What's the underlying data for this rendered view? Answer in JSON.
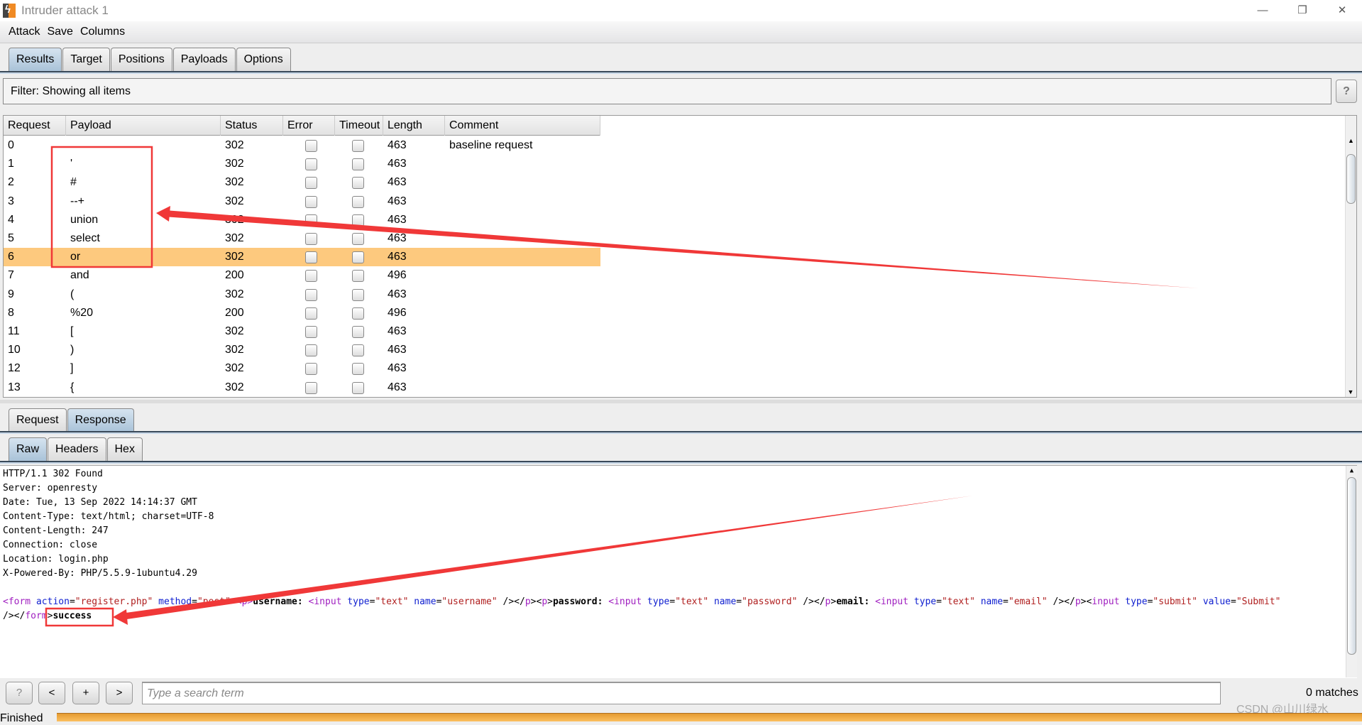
{
  "window": {
    "title": "Intruder attack 1",
    "icon": "burp-icon"
  },
  "menu": [
    "Attack",
    "Save",
    "Columns"
  ],
  "tabs": [
    "Results",
    "Target",
    "Positions",
    "Payloads",
    "Options"
  ],
  "filter": {
    "label": "Filter: Showing all items",
    "help": "?"
  },
  "table": {
    "columns": [
      "Request",
      "Payload",
      "Status",
      "Error",
      "Timeout",
      "Length",
      "Comment"
    ],
    "rows": [
      {
        "request": "0",
        "payload": "",
        "status": "302",
        "length": "463",
        "comment": "baseline request"
      },
      {
        "request": "1",
        "payload": "'",
        "status": "302",
        "length": "463",
        "comment": ""
      },
      {
        "request": "2",
        "payload": "#",
        "status": "302",
        "length": "463",
        "comment": ""
      },
      {
        "request": "3",
        "payload": "--+",
        "status": "302",
        "length": "463",
        "comment": ""
      },
      {
        "request": "4",
        "payload": "union",
        "status": "302",
        "length": "463",
        "comment": ""
      },
      {
        "request": "5",
        "payload": "select",
        "status": "302",
        "length": "463",
        "comment": ""
      },
      {
        "request": "6",
        "payload": "or",
        "status": "302",
        "length": "463",
        "comment": "",
        "selected": true
      },
      {
        "request": "7",
        "payload": "and",
        "status": "200",
        "length": "496",
        "comment": ""
      },
      {
        "request": "9",
        "payload": "(",
        "status": "302",
        "length": "463",
        "comment": ""
      },
      {
        "request": "8",
        "payload": "%20",
        "status": "200",
        "length": "496",
        "comment": ""
      },
      {
        "request": "11",
        "payload": "[",
        "status": "302",
        "length": "463",
        "comment": ""
      },
      {
        "request": "10",
        "payload": ")",
        "status": "302",
        "length": "463",
        "comment": ""
      },
      {
        "request": "12",
        "payload": "]",
        "status": "302",
        "length": "463",
        "comment": ""
      },
      {
        "request": "13",
        "payload": "{",
        "status": "302",
        "length": "463",
        "comment": ""
      }
    ]
  },
  "message_tabs": [
    "Request",
    "Response"
  ],
  "view_tabs": [
    "Raw",
    "Headers",
    "Hex"
  ],
  "response": {
    "headers": [
      "HTTP/1.1 302 Found",
      "Server: openresty",
      "Date: Tue, 13 Sep 2022 14:14:37 GMT",
      "Content-Type: text/html; charset=UTF-8",
      "Content-Length: 247",
      "Connection: close",
      "Location: login.php",
      "X-Powered-By: PHP/5.5.9-1ubuntu4.29"
    ],
    "body_line1": [
      [
        "<form ",
        "tag"
      ],
      [
        "action",
        "attr"
      ],
      [
        "=",
        ""
      ],
      [
        "\"register.php\"",
        "val"
      ],
      [
        " method",
        "attr"
      ],
      [
        "=",
        ""
      ],
      [
        "\"post\"",
        "val"
      ],
      [
        "><p>",
        "tag"
      ],
      [
        "username:",
        "bold"
      ],
      [
        " <input ",
        "tag"
      ],
      [
        "type",
        "attr"
      ],
      [
        "=",
        ""
      ],
      [
        "\"text\"",
        "val"
      ],
      [
        " name",
        "attr"
      ],
      [
        "=",
        ""
      ],
      [
        "\"username\"",
        "val"
      ],
      [
        " /></",
        ""
      ],
      [
        "p",
        "tag"
      ],
      [
        "><",
        ""
      ],
      [
        "p",
        "tag"
      ],
      [
        ">",
        ""
      ],
      [
        "password:",
        "bold"
      ],
      [
        " <input ",
        "tag"
      ],
      [
        "type",
        "attr"
      ],
      [
        "=",
        ""
      ],
      [
        "\"text\"",
        "val"
      ],
      [
        " name",
        "attr"
      ],
      [
        "=",
        ""
      ],
      [
        "\"password\"",
        "val"
      ],
      [
        " /></",
        ""
      ],
      [
        "p",
        "tag"
      ],
      [
        ">",
        ""
      ],
      [
        "email:",
        "bold"
      ],
      [
        " <input ",
        "tag"
      ],
      [
        "type",
        "attr"
      ],
      [
        "=",
        ""
      ],
      [
        "\"text\"",
        "val"
      ],
      [
        " name",
        "attr"
      ],
      [
        "=",
        ""
      ],
      [
        "\"email\"",
        "val"
      ],
      [
        " /></",
        ""
      ],
      [
        "p",
        "tag"
      ],
      [
        "><",
        ""
      ],
      [
        "input ",
        "tag"
      ],
      [
        "type",
        "attr"
      ],
      [
        "=",
        ""
      ],
      [
        "\"submit\"",
        "val"
      ],
      [
        " value",
        "attr"
      ],
      [
        "=",
        ""
      ],
      [
        "\"Submit\"",
        "val"
      ]
    ],
    "body_line2": [
      [
        "/></",
        ""
      ],
      [
        "form",
        "tag"
      ],
      [
        ">",
        ""
      ],
      [
        "success",
        "bold"
      ]
    ]
  },
  "search": {
    "buttons": [
      "?",
      "<",
      "+",
      ">"
    ],
    "placeholder": "Type a search term",
    "matches": "0 matches"
  },
  "status": "Finished",
  "watermark": "CSDN @山川绿水",
  "colors": {
    "selected_row": "#fdc97e",
    "annotation": "#f03838",
    "progress": "#f0a840"
  }
}
